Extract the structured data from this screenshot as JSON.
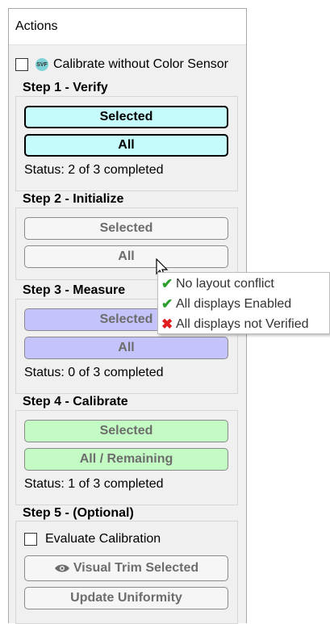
{
  "panel": {
    "title": "Actions"
  },
  "calibrate_option": {
    "label": "Calibrate without Color Sensor",
    "icon": "svf-icon",
    "icon_text": "SVF",
    "checked": false
  },
  "steps": [
    {
      "title": "Step 1 - Verify",
      "buttons": [
        "Selected",
        "All"
      ],
      "status": "Status: 2 of 3 completed"
    },
    {
      "title": "Step 2 - Initialize",
      "buttons": [
        "Selected",
        "All"
      ]
    },
    {
      "title": "Step 3 - Measure",
      "buttons": [
        "Selected",
        "All"
      ],
      "status": "Status: 0 of 3 completed"
    },
    {
      "title": "Step 4 - Calibrate",
      "buttons": [
        "Selected",
        "All / Remaining"
      ],
      "status": "Status: 1 of 3 completed"
    },
    {
      "title": "Step 5 - (Optional)",
      "checkbox_label": "Evaluate Calibration",
      "buttons": [
        "Visual Trim Selected",
        "Update Uniformity"
      ]
    }
  ],
  "tooltip": [
    {
      "icon": "check-icon",
      "mark": "✔",
      "text": "No layout conflict"
    },
    {
      "icon": "check-icon",
      "mark": "✔",
      "text": "All displays Enabled"
    },
    {
      "icon": "cross-icon",
      "mark": "✖",
      "text": "All displays not Verified"
    }
  ],
  "colors": {
    "verify_button": "#c5fbfb",
    "measure_button": "#c4c4fb",
    "calibrate_button": "#c4fbc4",
    "check": "#2e9e2e",
    "cross": "#e02020"
  }
}
